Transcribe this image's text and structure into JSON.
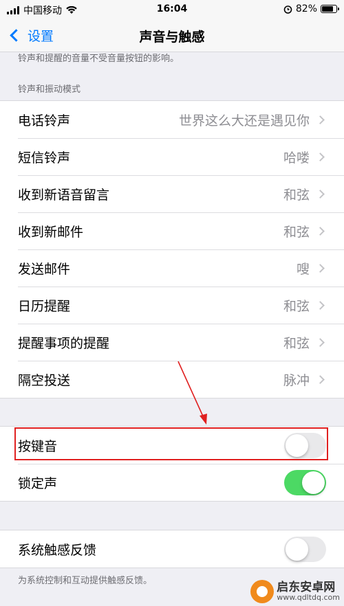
{
  "status_bar": {
    "carrier": "中国移动",
    "time": "16:04",
    "battery": "82%",
    "battery_level": 0.82
  },
  "nav": {
    "back_label": "设置",
    "title": "声音与触感"
  },
  "truncated_footer": "铃声和提醒的音量不受音量按钮的影响。",
  "section_header": "铃声和振动模式",
  "sounds": [
    {
      "label": "电话铃声",
      "value": "世界这么大还是遇见你"
    },
    {
      "label": "短信铃声",
      "value": "哈喽"
    },
    {
      "label": "收到新语音留言",
      "value": "和弦"
    },
    {
      "label": "收到新邮件",
      "value": "和弦"
    },
    {
      "label": "发送邮件",
      "value": "嗖"
    },
    {
      "label": "日历提醒",
      "value": "和弦"
    },
    {
      "label": "提醒事项的提醒",
      "value": "和弦"
    },
    {
      "label": "隔空投送",
      "value": "脉冲"
    }
  ],
  "toggles": [
    {
      "label": "按键音",
      "on": false
    },
    {
      "label": "锁定声",
      "on": true
    }
  ],
  "haptics": {
    "label": "系统触感反馈",
    "on": false,
    "footer": "为系统控制和互动提供触感反馈。"
  },
  "watermark": {
    "name": "启东安卓网",
    "url": "www.qdltdq.com"
  }
}
